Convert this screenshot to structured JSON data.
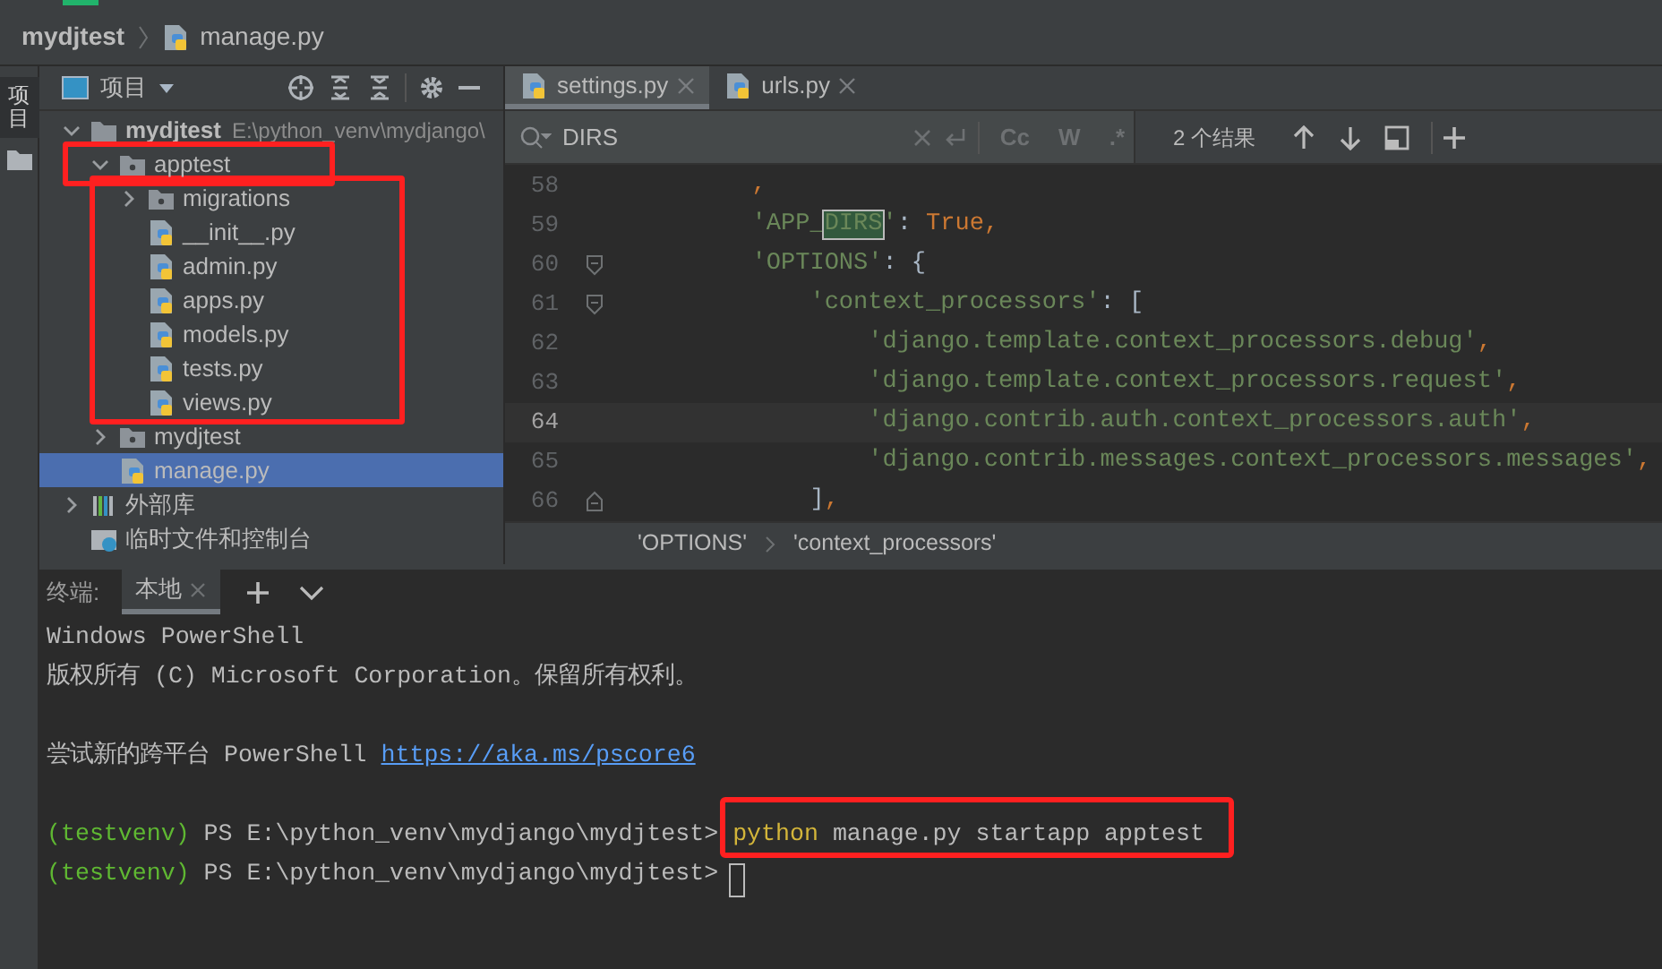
{
  "breadcrumb": {
    "project": "mydjtest",
    "file": "manage.py"
  },
  "side_strip": {
    "label": "项目"
  },
  "project_panel": {
    "title": "项目",
    "tree": [
      {
        "label": "mydjtest",
        "path": "E:\\python_venv\\mydjango\\",
        "kind": "folder",
        "expanded": true,
        "selected": false,
        "children": [
          {
            "label": "apptest",
            "kind": "package",
            "expanded": true,
            "selected": false,
            "boxed": true,
            "children_boxed": true,
            "children": [
              {
                "label": "migrations",
                "kind": "package",
                "expanded": false,
                "selected": false
              },
              {
                "label": "__init__.py",
                "kind": "python",
                "selected": false
              },
              {
                "label": "admin.py",
                "kind": "python",
                "selected": false
              },
              {
                "label": "apps.py",
                "kind": "python",
                "selected": false
              },
              {
                "label": "models.py",
                "kind": "python",
                "selected": false
              },
              {
                "label": "tests.py",
                "kind": "python",
                "selected": false
              },
              {
                "label": "views.py",
                "kind": "python",
                "selected": false
              }
            ]
          },
          {
            "label": "mydjtest",
            "kind": "package",
            "expanded": false,
            "selected": false
          },
          {
            "label": "manage.py",
            "kind": "python",
            "selected": true
          }
        ]
      },
      {
        "label": "外部库",
        "kind": "library",
        "expanded": false,
        "selected": false
      },
      {
        "label": "临时文件和控制台",
        "kind": "scratch",
        "selected": false
      }
    ]
  },
  "editor": {
    "tabs": [
      {
        "label": "settings.py",
        "selected": true
      },
      {
        "label": "urls.py",
        "selected": false
      }
    ],
    "search": {
      "query": "DIRS",
      "options": [
        "Cc",
        "W",
        ".*"
      ],
      "result": "2 个结果"
    },
    "lines": [
      {
        "number": "58",
        "current": false,
        "kind": "plain",
        "tokens": [
          {
            "text": "        ,",
            "kind": "punc"
          }
        ]
      },
      {
        "number": "59",
        "current": false,
        "kind": "plain",
        "tokens": [
          {
            "text": "        'APP_",
            "kind": "str"
          },
          {
            "text": "DIRS",
            "kind": "match"
          },
          {
            "text": "'",
            "kind": "str"
          },
          {
            "text": ": ",
            "kind": "plain"
          },
          {
            "text": "True,",
            "kind": "kw"
          }
        ]
      },
      {
        "number": "60",
        "current": false,
        "kind": "fold_start",
        "tokens": [
          {
            "text": "        'OPTIONS'",
            "kind": "str"
          },
          {
            "text": ": {",
            "kind": "plain"
          }
        ]
      },
      {
        "number": "61",
        "current": false,
        "kind": "fold_start",
        "tokens": [
          {
            "text": "            'context_processors'",
            "kind": "str"
          },
          {
            "text": ": [",
            "kind": "plain"
          }
        ]
      },
      {
        "number": "62",
        "current": false,
        "kind": "plain",
        "tokens": [
          {
            "text": "                'django.template.context_processors.debug'",
            "kind": "str"
          },
          {
            "text": ",",
            "kind": "punc"
          }
        ]
      },
      {
        "number": "63",
        "current": false,
        "kind": "plain",
        "tokens": [
          {
            "text": "                'django.template.context_processors.request'",
            "kind": "str"
          },
          {
            "text": ",",
            "kind": "punc"
          }
        ]
      },
      {
        "number": "64",
        "current": true,
        "kind": "plain",
        "tokens": [
          {
            "text": "                'django.contrib.auth.context_processors.auth'",
            "kind": "str"
          },
          {
            "text": ",",
            "kind": "punc"
          }
        ]
      },
      {
        "number": "65",
        "current": false,
        "kind": "plain",
        "tokens": [
          {
            "text": "                'django.contrib.messages.context_processors.messages'",
            "kind": "str"
          },
          {
            "text": ",",
            "kind": "punc"
          }
        ]
      },
      {
        "number": "66",
        "current": false,
        "kind": "fold_end",
        "tokens": [
          {
            "text": "            ]",
            "kind": "plain"
          },
          {
            "text": ",",
            "kind": "punc"
          }
        ]
      }
    ],
    "path": [
      "'OPTIONS'",
      "'context_processors'"
    ]
  },
  "terminal": {
    "label": "终端:",
    "tabs": [
      {
        "label": "本地",
        "selected": true
      }
    ],
    "lines": [
      {
        "kind": "text",
        "segments": [
          {
            "text": "Windows PowerShell",
            "kind": "plain"
          }
        ]
      },
      {
        "kind": "text",
        "segments": [
          {
            "text": "版权所有 (C) Microsoft Corporation。保留所有权利。",
            "kind": "plain"
          }
        ]
      },
      {
        "kind": "blank"
      },
      {
        "kind": "text",
        "segments": [
          {
            "text": "尝试新的跨平台 PowerShell ",
            "kind": "plain"
          },
          {
            "text": "https://aka.ms/pscore6",
            "kind": "link"
          }
        ]
      },
      {
        "kind": "blank"
      },
      {
        "kind": "prompt",
        "venv": "(testvenv)",
        "prompt": "PS E:\\python_venv\\mydjango\\mydjtest>",
        "boxed": true,
        "command": [
          {
            "text": "python",
            "kind": "exe"
          },
          {
            "text": "manage.py startapp apptest",
            "kind": "plain"
          }
        ]
      },
      {
        "kind": "prompt",
        "venv": "(testvenv)",
        "prompt": "PS E:\\python_venv\\mydjango\\mydjtest>",
        "cursor": true
      }
    ]
  }
}
